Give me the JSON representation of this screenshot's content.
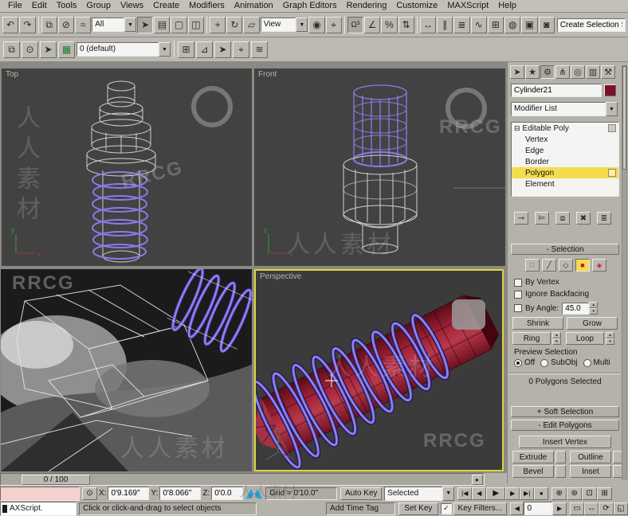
{
  "menu": {
    "items": [
      "File",
      "Edit",
      "Tools",
      "Group",
      "Views",
      "Create",
      "Modifiers",
      "Animation",
      "Graph Editors",
      "Rendering",
      "Customize",
      "MAXScript",
      "Help"
    ]
  },
  "toolbar": {
    "selection_filter": "All",
    "coord_system": "View",
    "named_sets": "Create Selection Se"
  },
  "toolbar2": {
    "layer": "0 (default)"
  },
  "viewports": {
    "top_label": "Top",
    "front_label": "Front",
    "perspective_label": "Perspective"
  },
  "command_panel": {
    "object_name": "Cylinder21",
    "modifier_list_label": "Modifier List",
    "stack_root": "Editable Poly",
    "stack_items": [
      "Vertex",
      "Edge",
      "Border",
      "Polygon",
      "Element"
    ],
    "selection": {
      "title": "- Selection",
      "by_vertex": "By Vertex",
      "ignore_backfacing": "Ignore Backfacing",
      "by_angle": "By Angle:",
      "angle_value": "45.0",
      "shrink": "Shrink",
      "grow": "Grow",
      "ring": "Ring",
      "loop": "Loop",
      "preview": "Preview Selection",
      "off": "Off",
      "subobj": "SubObj",
      "multi": "Multi",
      "status": "0 Polygons Selected"
    },
    "soft_selection_title": "+ Soft Selection",
    "edit_polygons_title": "- Edit Polygons",
    "insert_vertex": "Insert Vertex",
    "extrude": "Extrude",
    "outline": "Outline",
    "bevel": "Bevel",
    "inset": "Inset"
  },
  "trackbar": {
    "frame_display": "0 / 100"
  },
  "statusbar": {
    "listener_line": "AXScript.",
    "prompt": "Click or click-and-drag to select objects",
    "x_label": "X:",
    "x_value": "0'9.169\"",
    "y_label": "Y:",
    "y_value": "0'8.066\"",
    "z_label": "Z:",
    "z_value": "0'0.0",
    "grid": "Grid = 0'10.0\"",
    "add_time_tag": "Add Time Tag",
    "auto_key": "Auto Key",
    "set_key": "Set Key",
    "selected": "Selected",
    "key_filters": "Key Filters...",
    "time_value": "0"
  },
  "watermarks": {
    "brand": "RRCG",
    "site": "人人素材"
  },
  "colors": {
    "active_viewport_border": "#e0d23e",
    "stack_highlight": "#f3dc4e",
    "object_red": "#8e1c2c",
    "wireframe_purple": "#8a7ae6",
    "object_color_swatch": "#7a1025",
    "listener_pink": "#f6cfcf"
  },
  "icons": {
    "dropdown": "▼",
    "undo": "↶",
    "redo": "↷",
    "select_link": "⧉",
    "unlink": "⊘",
    "bind_spacewarp": "≈",
    "select_object": "➤",
    "select_by_name": "▤",
    "region_rect": "▢",
    "window_crossing": "◫",
    "move": "+",
    "rotate": "↻",
    "scale": "▱",
    "use_center": "◉",
    "manipulate": "⌖",
    "snaps": "Ω³",
    "angle_snap": "∠",
    "percent_snap": "%",
    "spinner_snap": "⇅",
    "mirror": "↔",
    "align": "∥",
    "layer_manager": "≣",
    "curve_editor": "∿",
    "schematic": "⊞",
    "material_editor": "◍",
    "render_setup": "▣",
    "quick_render": "◙",
    "shapes": "⧉",
    "eye": "⊙",
    "pointer": "➤",
    "cube": "▦",
    "grid_tool": "⊞",
    "axis_tool": "⊿",
    "go_tool": "➤",
    "target_tool": "⌖",
    "wave_tool": "≋",
    "tab_arrow": "➤",
    "tab_create": "★",
    "tab_modify": "⚙",
    "tab_hierarchy": "⋔",
    "tab_motion": "◎",
    "tab_display": "▥",
    "tab_utilities": "⚒",
    "stack_expand": "⊟",
    "pin_stack": "⊸",
    "show_end_result": "⊨",
    "make_unique": "⧈",
    "remove_modifier": "✖",
    "configure": "≣",
    "so_vertex": "∷",
    "so_edge": "╱",
    "so_border": "◇",
    "so_polygon": "■",
    "so_element": "◈",
    "spin_up": "▴",
    "spin_down": "▾",
    "lock": "⊙",
    "check": "✓",
    "go_start": "|◀",
    "prev_frame": "◀",
    "play": "▶",
    "next_frame": "▶",
    "go_end": "▶|",
    "key_mode": "●",
    "left_arrow": "◀",
    "right_arrow": "▶",
    "track_arrow": "▸",
    "zoom": "⊕",
    "zoom_all": "⊛",
    "zoom_extents": "⊡",
    "zoom_extents_all": "⊞",
    "zoom_region": "▭",
    "pan": "↔",
    "orbit": "⟳",
    "maximize": "◱"
  }
}
